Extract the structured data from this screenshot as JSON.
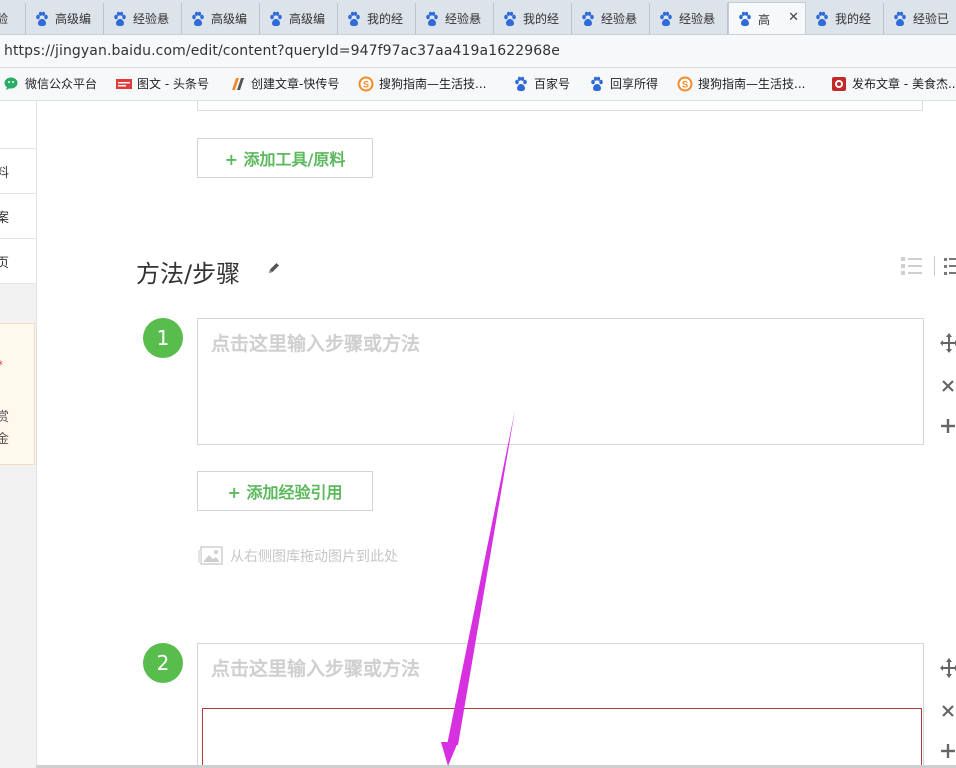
{
  "browser": {
    "tabs": [
      {
        "label": "经验",
        "active": false
      },
      {
        "label": "高级编",
        "active": false
      },
      {
        "label": "经验悬",
        "active": false
      },
      {
        "label": "高级编",
        "active": false
      },
      {
        "label": "高级编",
        "active": false
      },
      {
        "label": "我的经",
        "active": false
      },
      {
        "label": "经验悬",
        "active": false
      },
      {
        "label": "我的经",
        "active": false
      },
      {
        "label": "经验悬",
        "active": false
      },
      {
        "label": "经验悬",
        "active": false
      },
      {
        "label": "高",
        "active": true
      },
      {
        "label": "我的经",
        "active": false
      },
      {
        "label": "经验已",
        "active": false
      }
    ],
    "tab_close_glyph": "✕",
    "url": "https://jingyan.baidu.com/edit/content?queryId=947f97ac37aa419a1622968e",
    "bookmarks": [
      {
        "label": "微信公众平台",
        "icon": "wechat-icon"
      },
      {
        "label": "图文 - 头条号",
        "icon": "toutiao-icon"
      },
      {
        "label": "创建文章-快传号",
        "icon": "kuaichuan-icon"
      },
      {
        "label": "搜狗指南—生活技...",
        "icon": "sogou-icon"
      },
      {
        "label": "百家号",
        "icon": "baidu-paw-icon"
      },
      {
        "label": "回享所得",
        "icon": "baidu-paw-icon"
      },
      {
        "label": "搜狗指南—生活技...",
        "icon": "sogou-icon"
      },
      {
        "label": "发布文章 - 美食杰...",
        "icon": "meishijie-icon"
      }
    ]
  },
  "sidebar": {
    "items": [
      "料",
      "案",
      "页"
    ],
    "reward_star": "*",
    "reward_line1": "赏",
    "reward_line2": "金"
  },
  "editor": {
    "add_tools_button": "+ 添加工具/原料",
    "section_title": "方法/步骤",
    "steps": [
      {
        "number": "1",
        "placeholder": "点击这里输入步骤或方法"
      },
      {
        "number": "2",
        "placeholder": "点击这里输入步骤或方法"
      }
    ],
    "add_reference_button": "+ 添加经验引用",
    "image_drop_hint": "从右侧图库拖动图片到此处",
    "step_tools": {
      "move": "✥",
      "delete": "✕",
      "add": "✚"
    }
  },
  "colors": {
    "accent_green": "#5cb85c",
    "step_circle": "#58bd4d",
    "annotation_arrow": "#d630e0",
    "highlight_box": "#b33a3a"
  }
}
